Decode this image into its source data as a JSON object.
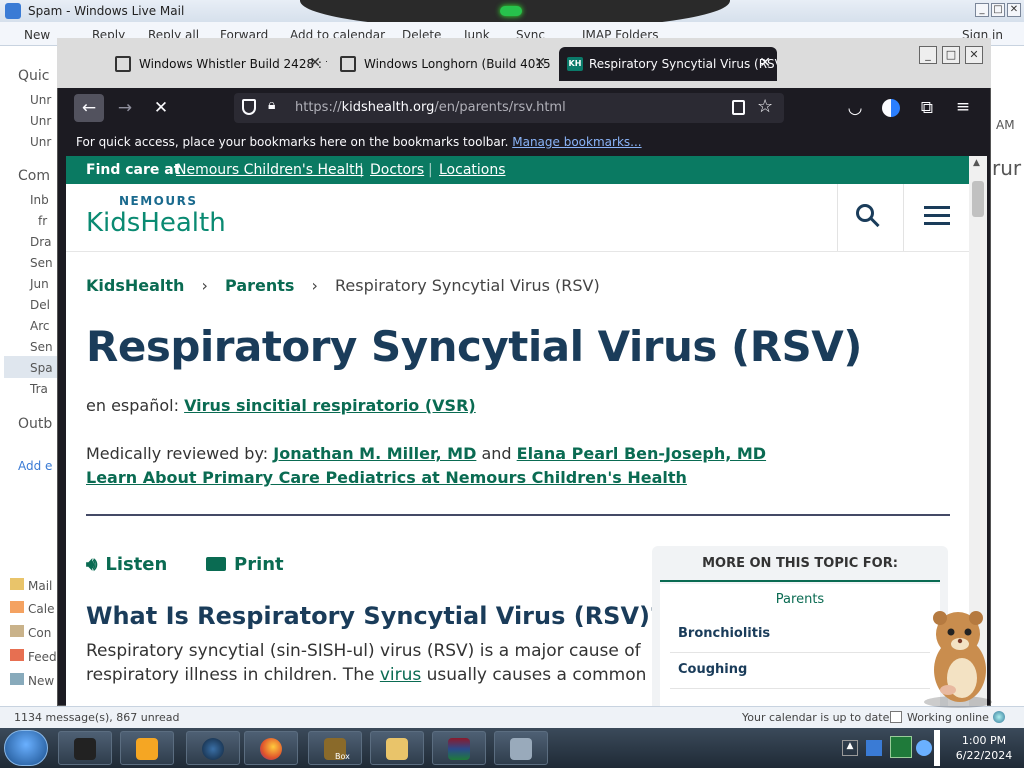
{
  "wlm": {
    "title": "Spam - Windows Live Mail",
    "menu": [
      "New",
      "Reply",
      "Reply all",
      "Forward",
      "Add to calendar",
      "Delete",
      "Junk",
      "Sync",
      "IMAP Folders",
      "Sign in"
    ],
    "left_items": [
      "Quic",
      "Unr",
      "Unr",
      "Unr",
      "Com",
      "Inb",
      "fr",
      "Dra",
      "Sen",
      "Jun",
      "Del",
      "Arc",
      "Sen",
      "Spa",
      "Tra",
      "Outb",
      "Add e"
    ],
    "bottom_nav": [
      "Mail",
      "Cale",
      "Con",
      "Feed",
      "New"
    ],
    "right_text": [
      "AM",
      "rur"
    ],
    "status_left": "1134 message(s), 867 unread",
    "status_right": "Your calendar is up to date",
    "status_online": "Working online"
  },
  "taskbar": {
    "clock_time": "1:00 PM",
    "clock_date": "6/22/2024",
    "box_label": "Box"
  },
  "firefox": {
    "tabs": [
      {
        "title": "Windows Whistler Build 2428 : f"
      },
      {
        "title": "Windows Longhorn (Build 4015"
      },
      {
        "title": "Respiratory Syncytial Virus (RSV"
      }
    ],
    "favicon_text": "KH",
    "url_prefix": "https://",
    "url_host": "kidshealth.org",
    "url_path": "/en/parents/rsv.html",
    "bookmark_text": "For quick access, place your bookmarks here on the bookmarks toolbar.",
    "bookmark_link": "Manage bookmarks..."
  },
  "page": {
    "find_care_label": "Find care at",
    "find_care_links": [
      "Nemours Children's Health",
      "Doctors",
      "Locations"
    ],
    "logo_top": "NEMOURS",
    "logo_main": "KidsHealth",
    "breadcrumbs": [
      "KidsHealth",
      "Parents",
      "Respiratory Syncytial Virus (RSV)"
    ],
    "title": "Respiratory Syncytial Virus (RSV)",
    "espanol_label": "en español:",
    "espanol_link": "Virus sincitial respiratorio (VSR)",
    "reviewed_label": "Medically reviewed by:",
    "reviewer_1": "Jonathan M. Miller, MD",
    "and": "and",
    "reviewer_2": "Elana Pearl Ben-Joseph, MD",
    "learn_link": "Learn About Primary Care Pediatrics at Nemours Children's Health",
    "listen": "Listen",
    "print": "Print",
    "h2": "What Is Respiratory Syncytial Virus (RSV)?",
    "body_line1": "Respiratory syncytial (sin-SISH-ul) virus (RSV) is a major cause of",
    "body_line2_a": "respiratory illness in children. The",
    "body_line2_link": "virus",
    "body_line2_b": "usually causes a common",
    "more_title": "MORE ON THIS TOPIC FOR:",
    "more_audience": "Parents",
    "more_items": [
      "Bronchiolitis",
      "Coughing"
    ]
  }
}
